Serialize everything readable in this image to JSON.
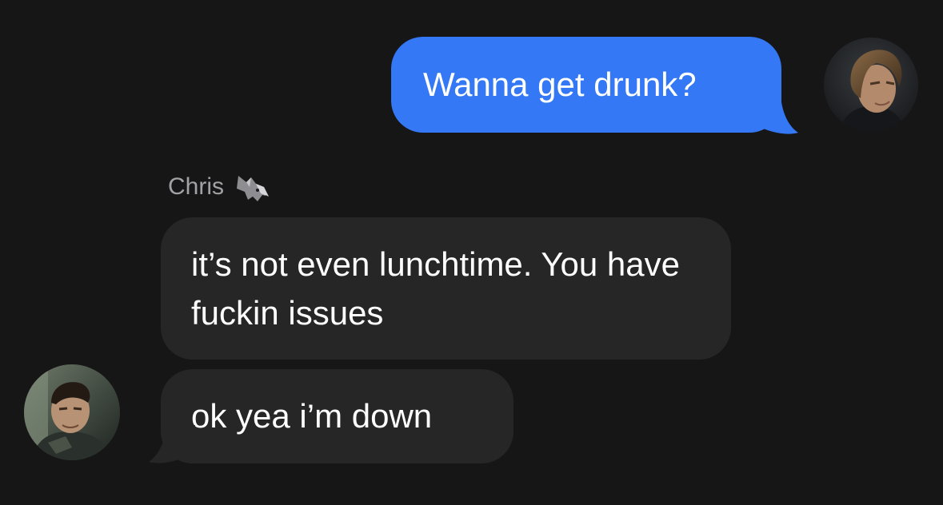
{
  "conversation": {
    "messages": [
      {
        "direction": "outgoing",
        "text": "Wanna get drunk?"
      },
      {
        "direction": "incoming",
        "sender": "Chris",
        "text": "it’s not even lunchtime. You have fuckin issues"
      },
      {
        "direction": "incoming",
        "sender": "Chris",
        "text": "ok yea i’m down"
      }
    ],
    "sender_name": "Chris",
    "sender_emoji": "wolf-icon"
  },
  "colors": {
    "background": "#161616",
    "outgoing_bubble": "#3478f6",
    "incoming_bubble": "#262626",
    "sender_label": "#a2a2a6"
  }
}
